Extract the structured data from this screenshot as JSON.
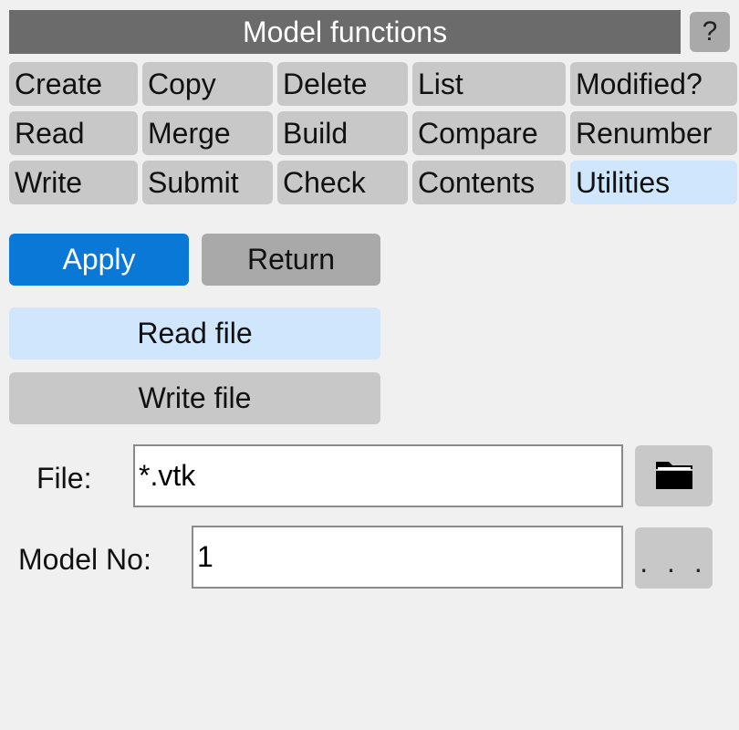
{
  "header": {
    "title": "Model functions",
    "help_label": "?"
  },
  "functions": [
    {
      "label": "Create"
    },
    {
      "label": "Copy"
    },
    {
      "label": "Delete"
    },
    {
      "label": "List"
    },
    {
      "label": "Modified?"
    },
    {
      "label": "Read"
    },
    {
      "label": "Merge"
    },
    {
      "label": "Build"
    },
    {
      "label": "Compare"
    },
    {
      "label": "Renumber"
    },
    {
      "label": "Write"
    },
    {
      "label": "Submit"
    },
    {
      "label": "Check"
    },
    {
      "label": "Contents"
    },
    {
      "label": "Utilities",
      "active": true
    }
  ],
  "actions": {
    "apply_label": "Apply",
    "return_label": "Return"
  },
  "modes": {
    "read_file_label": "Read file",
    "write_file_label": "Write file"
  },
  "file": {
    "label": "File:",
    "value": "*.vtk",
    "browse_icon": "folder-icon"
  },
  "model": {
    "label": "Model No:",
    "value": "1",
    "select_label": ". . ."
  },
  "colors": {
    "title_bg": "#6b6b6b",
    "apply_bg": "#0a78d7",
    "active_bg": "#cfe6fc",
    "button_bg": "#c8c8c8"
  }
}
